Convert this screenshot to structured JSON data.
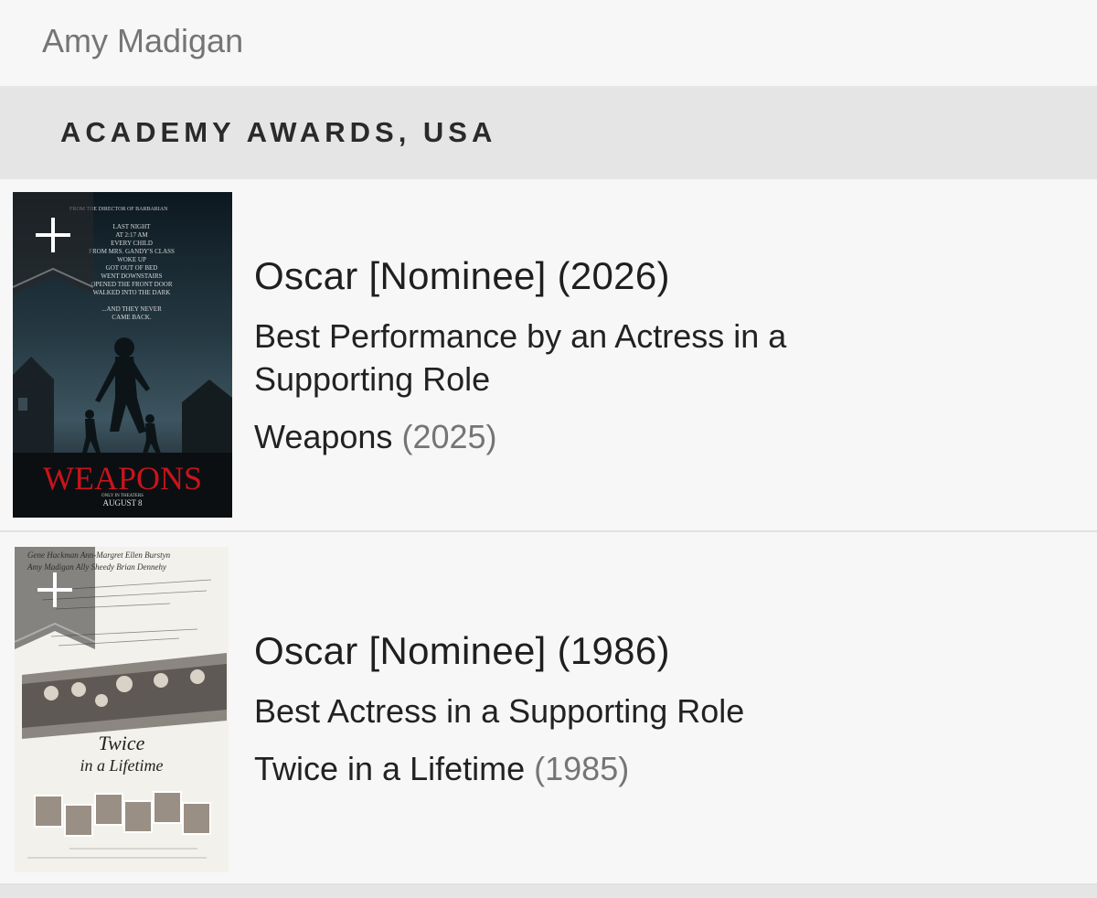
{
  "header": {
    "person_name": "Amy Madigan"
  },
  "section": {
    "title": "ACADEMY AWARDS, USA"
  },
  "awards": [
    {
      "award_title": "Oscar [Nominee] (2026)",
      "category": "Best Performance by an Actress in a Supporting Role",
      "film_title": "Weapons",
      "film_year": "(2025)",
      "poster": {
        "top_line": "FROM THE DIRECTOR OF BARBARIAN",
        "tagline": [
          "LAST NIGHT",
          "AT 2:17 AM",
          "EVERY CHILD",
          "FROM MRS. GANDY'S CLASS",
          "WOKE UP",
          "GOT OUT OF BED",
          "WENT DOWNSTAIRS",
          "OPENED THE FRONT DOOR",
          "WALKED INTO THE DARK",
          "...AND THEY NEVER",
          "CAME BACK."
        ],
        "title": "WEAPONS",
        "date_line": "ONLY IN THEATERS",
        "date": "AUGUST 8"
      }
    },
    {
      "award_title": "Oscar [Nominee] (1986)",
      "category": "Best Actress in a Supporting Role",
      "film_title": "Twice in a Lifetime",
      "film_year": "(1985)",
      "poster": {
        "cast_row1": "Gene Hackman   Ann-Margret   Ellen Burstyn",
        "cast_row2": "Amy Madigan   Ally Sheedy   Brian Dennehy",
        "title_line1": "Twice",
        "title_line2": "in a Lifetime"
      }
    }
  ],
  "icons": {
    "watchlist": "plus-icon",
    "ribbon": "bookmark-ribbon"
  },
  "colors": {
    "accent_red": "#c8141c",
    "name_gray": "#757575"
  }
}
